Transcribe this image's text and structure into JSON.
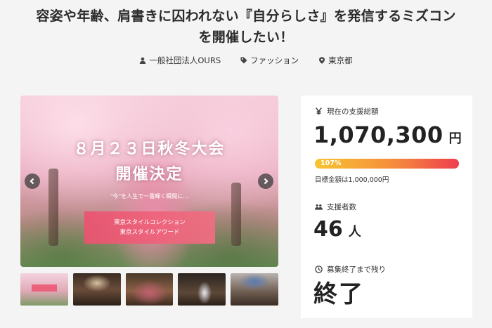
{
  "project": {
    "title_line1": "容姿や年齢、肩書きに囚われない『自分らしさ』を発信するミズコン",
    "title_line2": "を開催したい！",
    "organizer": "一般社団法人OURS",
    "category": "ファッション",
    "location": "東京都"
  },
  "hero": {
    "headline1": "８月２３日秋冬大会",
    "headline2": "開催決定",
    "tagline": "\"今\"を人生で一番輝く瞬間に…",
    "badge_line1": "東京スタイルコレクション",
    "badge_line2": "東京スタイルアワード"
  },
  "thumbnails": [
    {
      "name": "thumb-1"
    },
    {
      "name": "thumb-2"
    },
    {
      "name": "thumb-3"
    },
    {
      "name": "thumb-4"
    },
    {
      "name": "thumb-5"
    }
  ],
  "stats": {
    "funded_label": "現在の支援総額",
    "funded_amount": "1,070,300",
    "funded_unit": "円",
    "progress_text": "107%",
    "progress_percent": 107,
    "goal_text": "目標金額は1,000,000円",
    "backers_label": "支援者数",
    "backers_count": "46",
    "backers_unit": "人",
    "remaining_label": "募集終了まで残り",
    "remaining_value": "終了"
  },
  "icons": {
    "organizer": "person-icon",
    "category": "tag-icon",
    "location": "map-pin-icon",
    "funded": "yen-icon",
    "backers": "people-icon",
    "remaining": "clock-icon"
  },
  "colors": {
    "progress_start": "#f7c430",
    "progress_end": "#ee3d4e",
    "badge": "#ec5270",
    "background": "#f4f4f4"
  }
}
